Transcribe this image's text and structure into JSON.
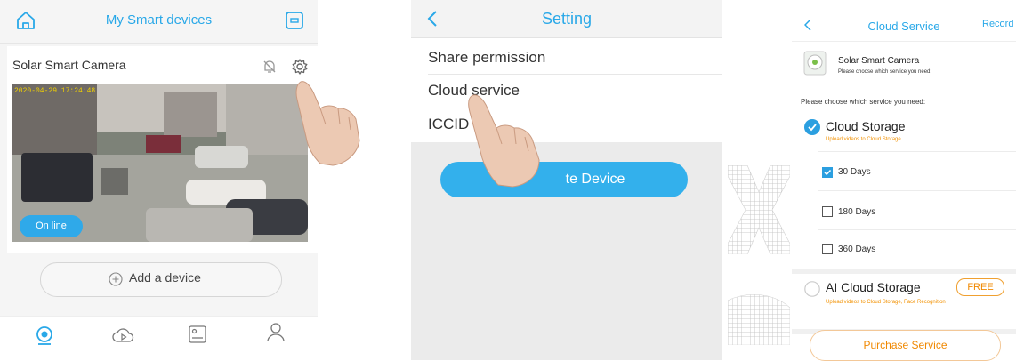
{
  "panel1": {
    "title": "My Smart devices",
    "device_name": "Solar Smart Camera",
    "timestamp": "2020-04-29 17:24:48",
    "online_badge": "On line",
    "add_device": "Add a device",
    "tabs": [
      "camera-tab",
      "cloud-play-tab",
      "album-tab",
      "profile-tab"
    ]
  },
  "panel2": {
    "title": "Setting",
    "items": [
      "Share permission",
      "Cloud service",
      "ICCID"
    ],
    "delete_button": "Delete Device",
    "delete_button_visible": "te Device"
  },
  "panel3": {
    "title": "Cloud Service",
    "record": "Record",
    "camera_name": "Solar Smart Camera",
    "camera_sub": "Please choose which service you need:",
    "choose_label": "Please choose which service you need:",
    "cloud_storage": {
      "title": "Cloud Storage",
      "subtitle": "Upload videos to Cloud Storage",
      "options": [
        {
          "label": "30 Days",
          "checked": true
        },
        {
          "label": "180 Days",
          "checked": false
        },
        {
          "label": "360 Days",
          "checked": false
        }
      ]
    },
    "ai_storage": {
      "title": "AI Cloud Storage",
      "badge": "FREE",
      "subtitle": "Upload videos to Cloud Storage, Face Recognition"
    },
    "purchase": "Purchase Service"
  },
  "colors": {
    "accent_blue": "#29a8e8",
    "accent_orange": "#f08800"
  }
}
